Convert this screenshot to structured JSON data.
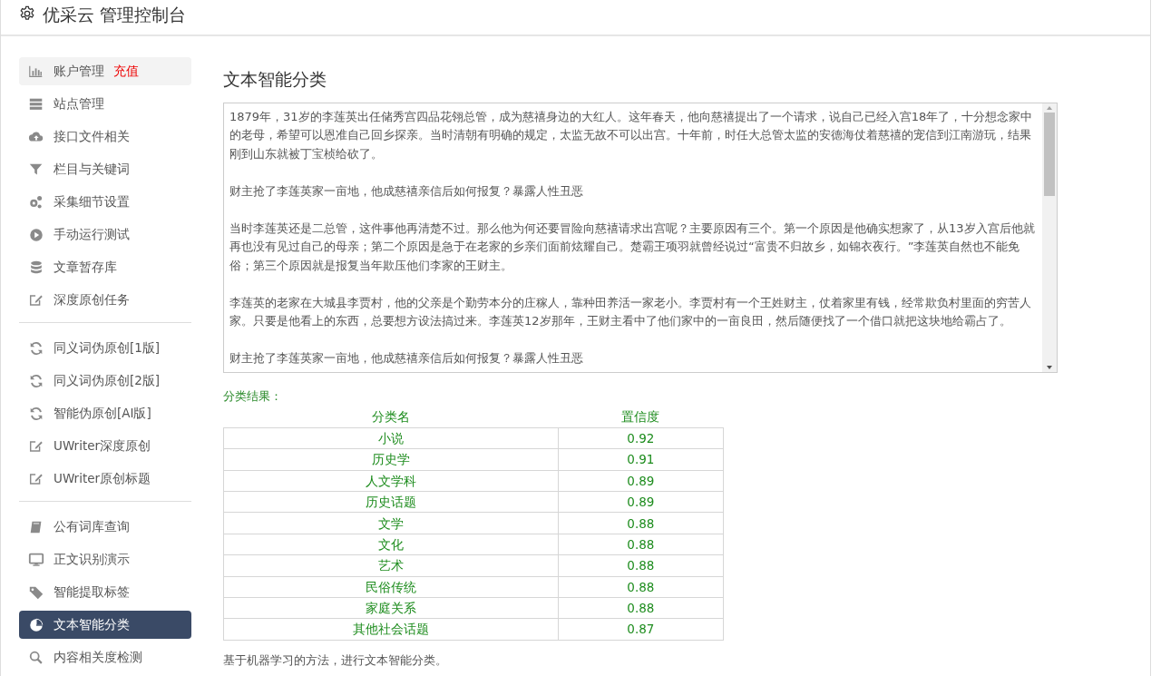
{
  "header": {
    "title": "优采云 管理控制台"
  },
  "sidebar": {
    "groups": [
      [
        {
          "label": "账户管理",
          "badge": "充值",
          "highlighted": true,
          "selected": false
        },
        {
          "label": "站点管理",
          "highlighted": false,
          "selected": false
        },
        {
          "label": "接口文件相关",
          "highlighted": false,
          "selected": false
        },
        {
          "label": "栏目与关键词",
          "highlighted": false,
          "selected": false
        },
        {
          "label": "采集细节设置",
          "highlighted": false,
          "selected": false
        },
        {
          "label": "手动运行测试",
          "highlighted": false,
          "selected": false
        },
        {
          "label": "文章暂存库",
          "highlighted": false,
          "selected": false
        },
        {
          "label": "深度原创任务",
          "highlighted": false,
          "selected": false
        }
      ],
      [
        {
          "label": "同义词伪原创[1版]",
          "highlighted": false,
          "selected": false
        },
        {
          "label": "同义词伪原创[2版]",
          "highlighted": false,
          "selected": false
        },
        {
          "label": "智能伪原创[AI版]",
          "highlighted": false,
          "selected": false
        },
        {
          "label": "UWriter深度原创",
          "highlighted": false,
          "selected": false
        },
        {
          "label": "UWriter原创标题",
          "highlighted": false,
          "selected": false
        }
      ],
      [
        {
          "label": "公有词库查询",
          "highlighted": false,
          "selected": false
        },
        {
          "label": "正文识别演示",
          "highlighted": false,
          "selected": false
        },
        {
          "label": "智能提取标签",
          "highlighted": false,
          "selected": false
        },
        {
          "label": "文本智能分类",
          "highlighted": false,
          "selected": true
        },
        {
          "label": "内容相关度检测",
          "highlighted": false,
          "selected": false
        }
      ]
    ]
  },
  "main": {
    "title": "文本智能分类",
    "text_input": {
      "paragraphs": [
        "1879年，31岁的李莲英出任储秀宫四品花翎总管，成为慈禧身边的大红人。这年春天，他向慈禧提出了一个请求，说自己已经入宫18年了，十分想念家中的老母，希望可以恩准自己回乡探亲。当时清朝有明确的规定，太监无故不可以出宫。十年前，时任大总管太监的安德海仗着慈禧的宠信到江南游玩，结果刚到山东就被丁宝桢给砍了。",
        "财主抢了李莲英家一亩地，他成慈禧亲信后如何报复？暴露人性丑恶",
        "当时李莲英还是二总管，这件事他再清楚不过。那么他为何还要冒险向慈禧请求出宫呢？主要原因有三个。第一个原因是他确实想家了，从13岁入宫后他就再也没有见过自己的母亲；第二个原因是急于在老家的乡亲们面前炫耀自己。楚霸王项羽就曾经说过“富贵不归故乡，如锦衣夜行。”李莲英自然也不能免俗；第三个原因就是报复当年欺压他们李家的王财主。",
        "李莲英的老家在大城县李贾村，他的父亲是个勤劳本分的庄稼人，靠种田养活一家老小。李贾村有一个王姓财主，仗着家里有钱，经常欺负村里面的穷苦人家。只要是他看上的东西，总要想方设法搞过来。李莲英12岁那年，王财主看中了他们家中的一亩良田，然后随便找了一个借口就把这块地给霸占了。",
        "财主抢了李莲英家一亩地，他成慈禧亲信后如何报复？暴露人性丑恶"
      ]
    },
    "result_label": "分类结果：",
    "table": {
      "columns": [
        "分类名",
        "置信度"
      ],
      "rows": [
        [
          "小说",
          "0.92"
        ],
        [
          "历史学",
          "0.91"
        ],
        [
          "人文学科",
          "0.89"
        ],
        [
          "历史话题",
          "0.89"
        ],
        [
          "文学",
          "0.88"
        ],
        [
          "文化",
          "0.88"
        ],
        [
          "艺术",
          "0.88"
        ],
        [
          "民俗传统",
          "0.88"
        ],
        [
          "家庭关系",
          "0.88"
        ],
        [
          "其他社会话题",
          "0.87"
        ]
      ]
    },
    "note": "基于机器学习的方法，进行文本智能分类。"
  }
}
